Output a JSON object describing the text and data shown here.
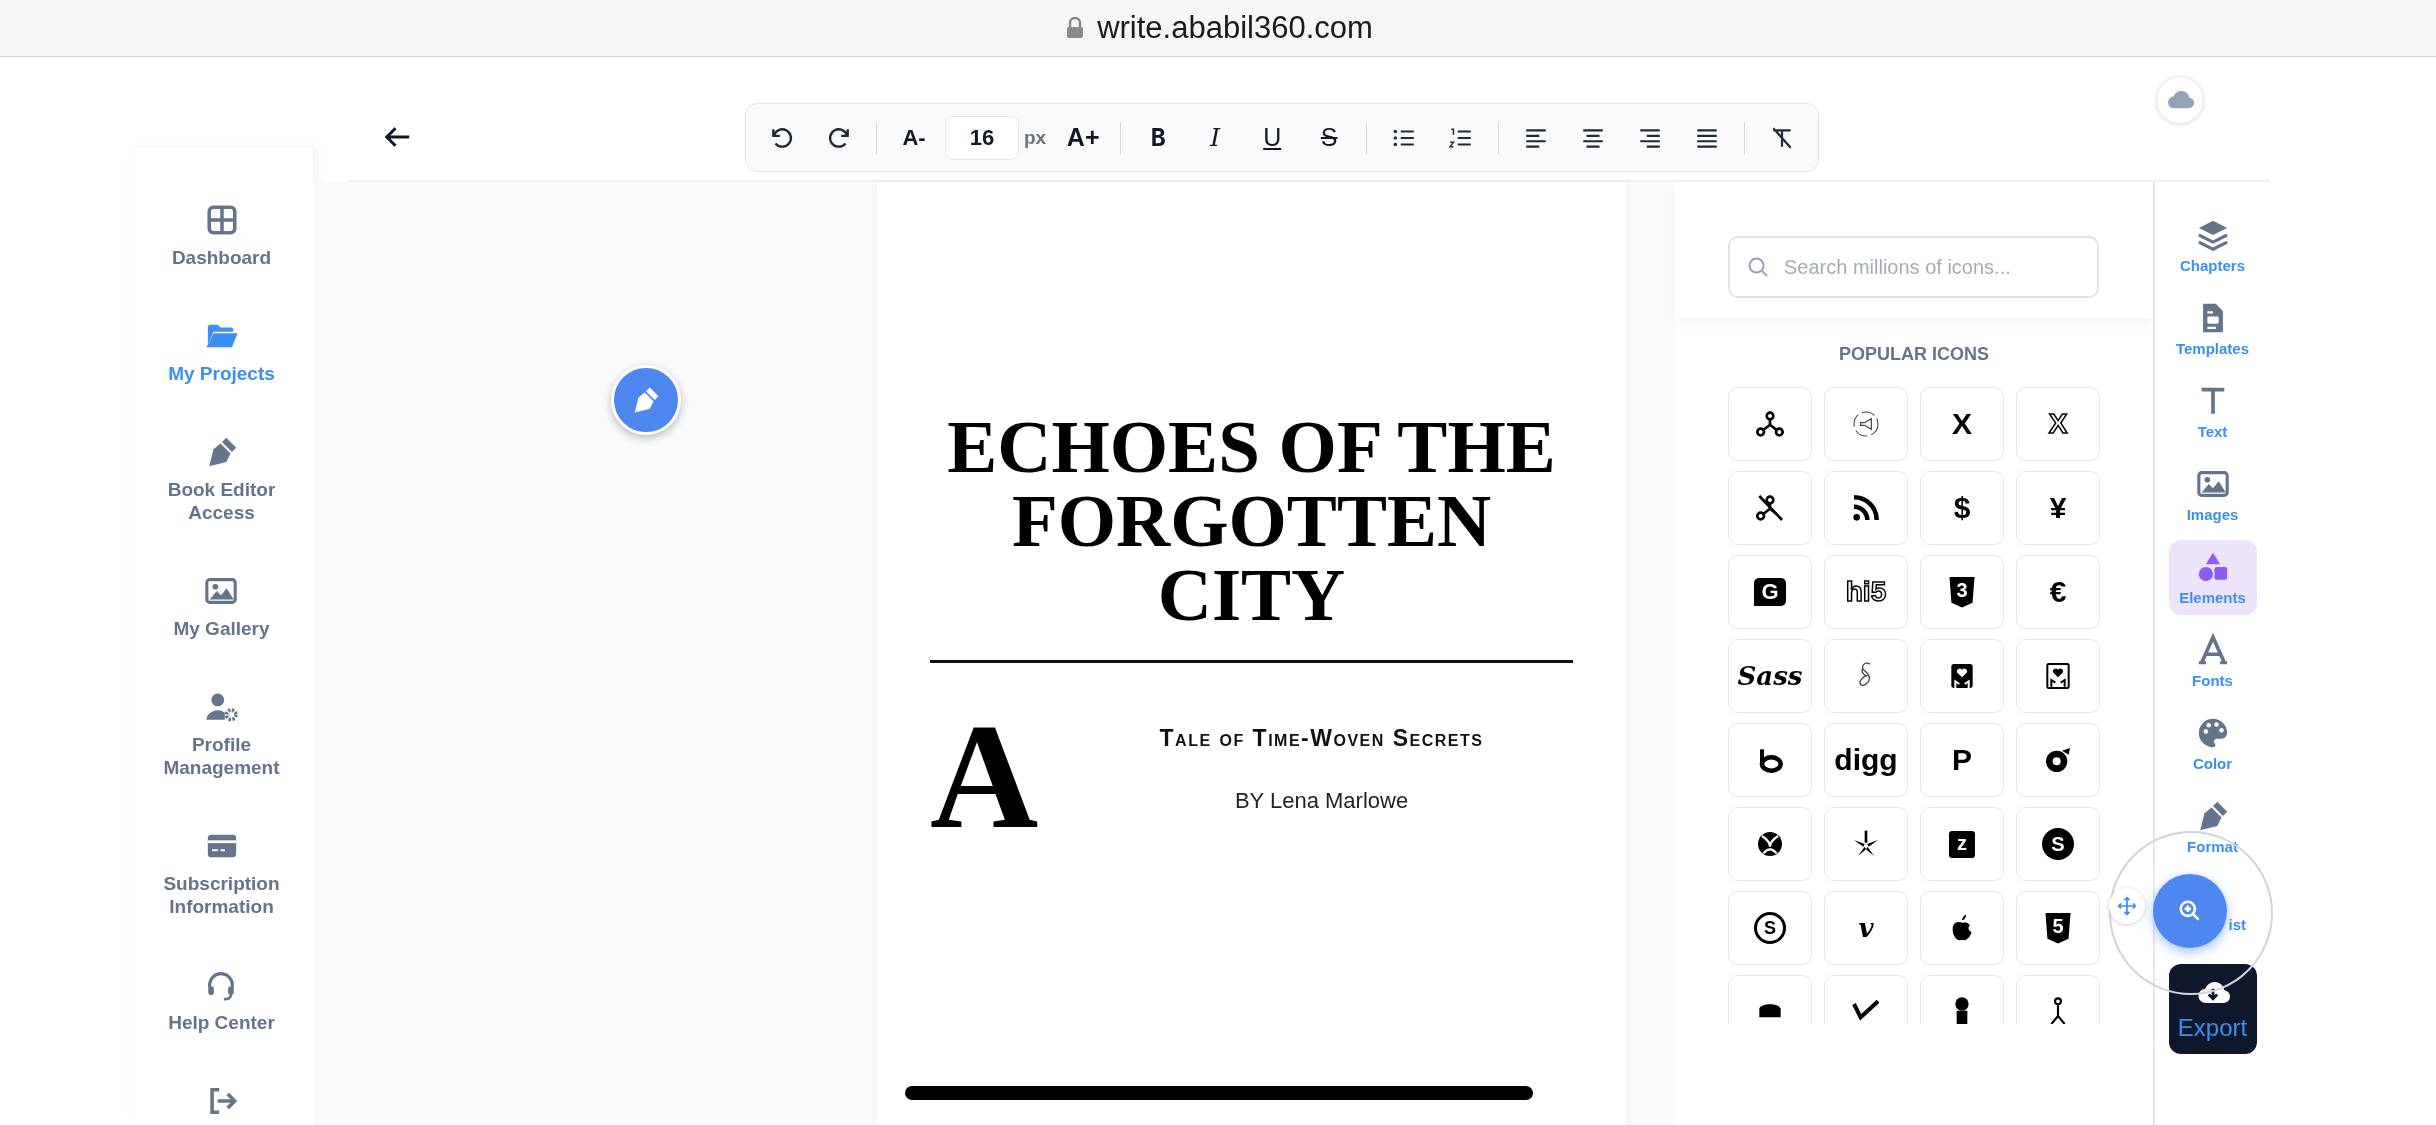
{
  "browser": {
    "url": "write.ababil360.com"
  },
  "sidebar": {
    "items": [
      {
        "label": "Dashboard",
        "kind": "grid",
        "selected": false
      },
      {
        "label": "My Projects",
        "kind": "folder",
        "selected": true
      },
      {
        "label": "Book Editor Access",
        "kind": "pen-nib",
        "selected": false
      },
      {
        "label": "My Gallery",
        "kind": "image",
        "selected": false
      },
      {
        "label": "Profile Management",
        "kind": "user-gear",
        "selected": false
      },
      {
        "label": "Subscription Information",
        "kind": "credit-card",
        "selected": false
      },
      {
        "label": "Help Center",
        "kind": "headset",
        "selected": false
      },
      {
        "kind": "logout",
        "selected": false
      }
    ]
  },
  "toolbar": {
    "items": [
      {
        "kind": "undo"
      },
      {
        "kind": "redo"
      },
      {
        "kind": "divider"
      },
      {
        "kind": "size-down",
        "text": "A-"
      },
      {
        "kind": "size-field",
        "value": "16",
        "unit": "px"
      },
      {
        "kind": "size-up",
        "text": "A+"
      },
      {
        "kind": "divider"
      },
      {
        "kind": "bold",
        "text": "B"
      },
      {
        "kind": "italic",
        "text": "I"
      },
      {
        "kind": "underline",
        "text": "U"
      },
      {
        "kind": "strike",
        "text": "S"
      },
      {
        "kind": "divider"
      },
      {
        "kind": "bullets"
      },
      {
        "kind": "numbers"
      },
      {
        "kind": "divider"
      },
      {
        "kind": "align-left"
      },
      {
        "kind": "align-center"
      },
      {
        "kind": "align-right"
      },
      {
        "kind": "justify"
      },
      {
        "kind": "divider"
      },
      {
        "kind": "clear-format"
      }
    ]
  },
  "document": {
    "title": "ECHOES OF THE FORGOTTEN CITY",
    "drop_cap": "A",
    "subtitle": "Tale of Time-Woven Secrets",
    "byline": "BY Lena Marlowe"
  },
  "icon_panel": {
    "search": {
      "placeholder": "Search millions of icons..."
    },
    "heading": "POPULAR ICONS",
    "icons": [
      {
        "kind": "nodes"
      },
      {
        "kind": "megaphone"
      },
      {
        "kind": "glyph",
        "text": "X"
      },
      {
        "kind": "outline",
        "text": "X"
      },
      {
        "kind": "nodes-crossed"
      },
      {
        "kind": "rss"
      },
      {
        "kind": "glyph",
        "text": "$"
      },
      {
        "kind": "glyph",
        "text": "¥"
      },
      {
        "kind": "bubble",
        "text": "G"
      },
      {
        "kind": "outline",
        "text": "hi5"
      },
      {
        "kind": "shield",
        "text": "3"
      },
      {
        "kind": "glyph",
        "text": "€"
      },
      {
        "kind": "script",
        "text": "Sass"
      },
      {
        "kind": "swirl"
      },
      {
        "kind": "hands-heart"
      },
      {
        "kind": "hands-heart-framed"
      },
      {
        "kind": "ring-b"
      },
      {
        "kind": "glyph",
        "text": "digg"
      },
      {
        "kind": "glyph",
        "text": "P"
      },
      {
        "kind": "disc-note"
      },
      {
        "kind": "ball"
      },
      {
        "kind": "burst"
      },
      {
        "kind": "tile",
        "text": "z"
      },
      {
        "kind": "disc",
        "text": "S"
      },
      {
        "kind": "ring",
        "text": "S"
      },
      {
        "kind": "script",
        "text": "v"
      },
      {
        "kind": "apple"
      },
      {
        "kind": "shield",
        "text": "5"
      },
      {
        "kind": "blob"
      },
      {
        "kind": "check"
      },
      {
        "kind": "drop"
      },
      {
        "kind": "figure"
      }
    ]
  },
  "rail": {
    "items": [
      {
        "label": "Chapters",
        "kind": "layers",
        "selected": false
      },
      {
        "label": "Templates",
        "kind": "document",
        "selected": false
      },
      {
        "label": "Text",
        "kind": "letter-t",
        "selected": false
      },
      {
        "label": "Images",
        "kind": "image",
        "selected": false
      },
      {
        "label": "Elements",
        "kind": "shapes",
        "selected": true
      },
      {
        "label": "Fonts",
        "kind": "letter-a",
        "selected": false
      },
      {
        "label": "Color",
        "kind": "palette",
        "selected": false
      },
      {
        "label": "Format",
        "kind": "pen-nib",
        "selected": false
      },
      {
        "label": "ist",
        "selected": false,
        "covered": true
      }
    ]
  },
  "export": {
    "label": "Export"
  }
}
